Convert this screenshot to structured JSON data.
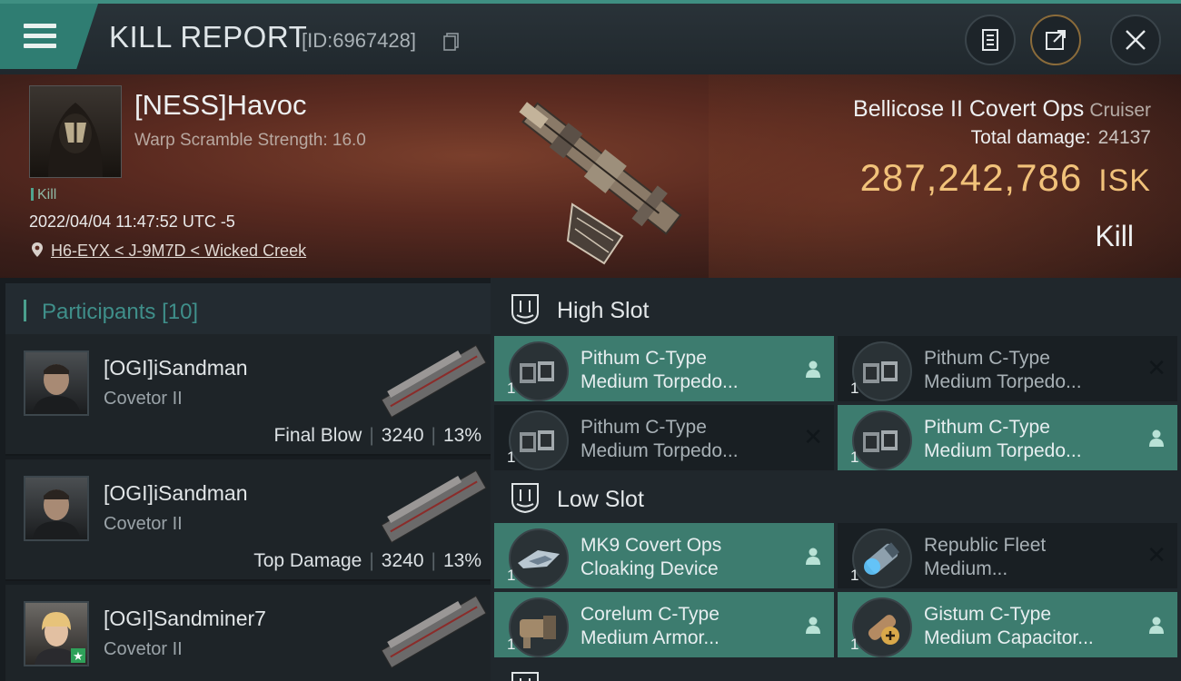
{
  "header": {
    "title": "KILL REPORT",
    "id_text": "[ID:6967428]"
  },
  "victim": {
    "pilot": "[NESS]Havoc",
    "detail": "Warp Scramble Strength: 16.0",
    "tag": "Kill",
    "datetime": "2022/04/04 11:47:52 UTC -5",
    "location": "H6-EYX < J-9M7D < Wicked Creek",
    "ship": "Bellicose II Covert Ops",
    "ship_class": "Cruiser",
    "total_damage_label": "Total damage:",
    "total_damage": "24137",
    "isk_value": "287,242,786",
    "isk_unit": "ISK",
    "result": "Kill"
  },
  "participants": {
    "label": "Participants",
    "count": "[10]",
    "rows": [
      {
        "name": "[OGI]iSandman",
        "ship": "Covetor II",
        "role": "Final Blow",
        "damage": "3240",
        "pct": "13%"
      },
      {
        "name": "[OGI]iSandman",
        "ship": "Covetor II",
        "role": "Top Damage",
        "damage": "3240",
        "pct": "13%"
      },
      {
        "name": "[OGI]Sandminer7",
        "ship": "Covetor II",
        "role": "",
        "damage": "",
        "pct": ""
      }
    ]
  },
  "slots": {
    "high": {
      "label": "High Slot",
      "modules": [
        {
          "line1": "Pithum C-Type",
          "line2": "Medium Torpedo...",
          "qty": "1",
          "state": "active"
        },
        {
          "line1": "Pithum C-Type",
          "line2": "Medium Torpedo...",
          "qty": "1",
          "state": "inactive"
        },
        {
          "line1": "Pithum C-Type",
          "line2": "Medium Torpedo...",
          "qty": "1",
          "state": "inactive"
        },
        {
          "line1": "Pithum C-Type",
          "line2": "Medium Torpedo...",
          "qty": "1",
          "state": "active"
        }
      ]
    },
    "low": {
      "label": "Low Slot",
      "modules": [
        {
          "line1": "MK9 Covert Ops",
          "line2": "Cloaking Device",
          "qty": "1",
          "state": "active"
        },
        {
          "line1": "Republic Fleet",
          "line2": "Medium...",
          "qty": "1",
          "state": "inactive"
        },
        {
          "line1": "Corelum C-Type",
          "line2": "Medium Armor...",
          "qty": "1",
          "state": "active"
        },
        {
          "line1": "Gistum C-Type",
          "line2": "Medium Capacitor...",
          "qty": "1",
          "state": "active"
        }
      ]
    }
  },
  "colors": {
    "accent": "#3d7c6f",
    "isk": "#f1c27a",
    "participants_label": "#3f8f8a"
  },
  "icons": [
    "menu-icon",
    "clipboard-icon",
    "share-icon",
    "close-icon",
    "copy-icon",
    "location-pin-icon",
    "high-slot-icon",
    "low-slot-icon",
    "person-icon",
    "x-icon"
  ]
}
